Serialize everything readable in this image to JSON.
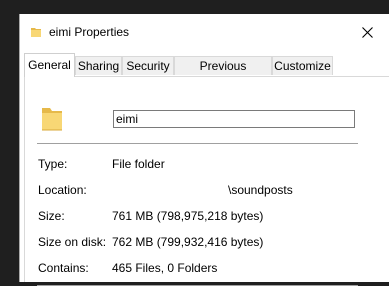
{
  "window": {
    "title": "eimi Properties",
    "close_glyph": "✕"
  },
  "tabs": [
    {
      "label": "General",
      "active": true
    },
    {
      "label": "Sharing",
      "active": false
    },
    {
      "label": "Security",
      "active": false
    },
    {
      "label": "Previous Versions",
      "active": false
    },
    {
      "label": "Customize",
      "active": false
    }
  ],
  "general": {
    "name_value": "eimi",
    "type_label": "Type:",
    "type_value": "File folder",
    "location_label": "Location:",
    "location_value": "\\soundposts",
    "size_label": "Size:",
    "size_value": "761 MB (798,975,218 bytes)",
    "size_on_disk_label": "Size on disk:",
    "size_on_disk_value": "762 MB (799,932,416 bytes)",
    "contains_label": "Contains:",
    "contains_value": "465 Files, 0 Folders"
  },
  "colors": {
    "background": "#1f1f1f",
    "folder_yellow": "#f8d775",
    "folder_dark": "#e6b94a"
  }
}
